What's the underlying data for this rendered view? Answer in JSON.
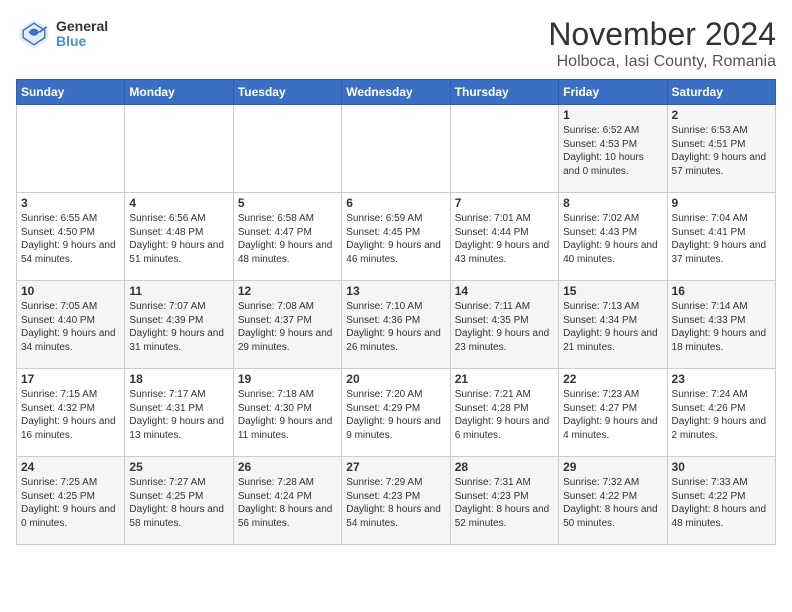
{
  "logo": {
    "general": "General",
    "blue": "Blue"
  },
  "title": "November 2024",
  "subtitle": "Holboca, Iasi County, Romania",
  "weekdays": [
    "Sunday",
    "Monday",
    "Tuesday",
    "Wednesday",
    "Thursday",
    "Friday",
    "Saturday"
  ],
  "weeks": [
    [
      {
        "day": "",
        "info": ""
      },
      {
        "day": "",
        "info": ""
      },
      {
        "day": "",
        "info": ""
      },
      {
        "day": "",
        "info": ""
      },
      {
        "day": "",
        "info": ""
      },
      {
        "day": "1",
        "info": "Sunrise: 6:52 AM\nSunset: 4:53 PM\nDaylight: 10 hours\nand 0 minutes."
      },
      {
        "day": "2",
        "info": "Sunrise: 6:53 AM\nSunset: 4:51 PM\nDaylight: 9 hours\nand 57 minutes."
      }
    ],
    [
      {
        "day": "3",
        "info": "Sunrise: 6:55 AM\nSunset: 4:50 PM\nDaylight: 9 hours\nand 54 minutes."
      },
      {
        "day": "4",
        "info": "Sunrise: 6:56 AM\nSunset: 4:48 PM\nDaylight: 9 hours\nand 51 minutes."
      },
      {
        "day": "5",
        "info": "Sunrise: 6:58 AM\nSunset: 4:47 PM\nDaylight: 9 hours\nand 48 minutes."
      },
      {
        "day": "6",
        "info": "Sunrise: 6:59 AM\nSunset: 4:45 PM\nDaylight: 9 hours\nand 46 minutes."
      },
      {
        "day": "7",
        "info": "Sunrise: 7:01 AM\nSunset: 4:44 PM\nDaylight: 9 hours\nand 43 minutes."
      },
      {
        "day": "8",
        "info": "Sunrise: 7:02 AM\nSunset: 4:43 PM\nDaylight: 9 hours\nand 40 minutes."
      },
      {
        "day": "9",
        "info": "Sunrise: 7:04 AM\nSunset: 4:41 PM\nDaylight: 9 hours\nand 37 minutes."
      }
    ],
    [
      {
        "day": "10",
        "info": "Sunrise: 7:05 AM\nSunset: 4:40 PM\nDaylight: 9 hours\nand 34 minutes."
      },
      {
        "day": "11",
        "info": "Sunrise: 7:07 AM\nSunset: 4:39 PM\nDaylight: 9 hours\nand 31 minutes."
      },
      {
        "day": "12",
        "info": "Sunrise: 7:08 AM\nSunset: 4:37 PM\nDaylight: 9 hours\nand 29 minutes."
      },
      {
        "day": "13",
        "info": "Sunrise: 7:10 AM\nSunset: 4:36 PM\nDaylight: 9 hours\nand 26 minutes."
      },
      {
        "day": "14",
        "info": "Sunrise: 7:11 AM\nSunset: 4:35 PM\nDaylight: 9 hours\nand 23 minutes."
      },
      {
        "day": "15",
        "info": "Sunrise: 7:13 AM\nSunset: 4:34 PM\nDaylight: 9 hours\nand 21 minutes."
      },
      {
        "day": "16",
        "info": "Sunrise: 7:14 AM\nSunset: 4:33 PM\nDaylight: 9 hours\nand 18 minutes."
      }
    ],
    [
      {
        "day": "17",
        "info": "Sunrise: 7:15 AM\nSunset: 4:32 PM\nDaylight: 9 hours\nand 16 minutes."
      },
      {
        "day": "18",
        "info": "Sunrise: 7:17 AM\nSunset: 4:31 PM\nDaylight: 9 hours\nand 13 minutes."
      },
      {
        "day": "19",
        "info": "Sunrise: 7:18 AM\nSunset: 4:30 PM\nDaylight: 9 hours\nand 11 minutes."
      },
      {
        "day": "20",
        "info": "Sunrise: 7:20 AM\nSunset: 4:29 PM\nDaylight: 9 hours\nand 9 minutes."
      },
      {
        "day": "21",
        "info": "Sunrise: 7:21 AM\nSunset: 4:28 PM\nDaylight: 9 hours\nand 6 minutes."
      },
      {
        "day": "22",
        "info": "Sunrise: 7:23 AM\nSunset: 4:27 PM\nDaylight: 9 hours\nand 4 minutes."
      },
      {
        "day": "23",
        "info": "Sunrise: 7:24 AM\nSunset: 4:26 PM\nDaylight: 9 hours\nand 2 minutes."
      }
    ],
    [
      {
        "day": "24",
        "info": "Sunrise: 7:25 AM\nSunset: 4:25 PM\nDaylight: 9 hours\nand 0 minutes."
      },
      {
        "day": "25",
        "info": "Sunrise: 7:27 AM\nSunset: 4:25 PM\nDaylight: 8 hours\nand 58 minutes."
      },
      {
        "day": "26",
        "info": "Sunrise: 7:28 AM\nSunset: 4:24 PM\nDaylight: 8 hours\nand 56 minutes."
      },
      {
        "day": "27",
        "info": "Sunrise: 7:29 AM\nSunset: 4:23 PM\nDaylight: 8 hours\nand 54 minutes."
      },
      {
        "day": "28",
        "info": "Sunrise: 7:31 AM\nSunset: 4:23 PM\nDaylight: 8 hours\nand 52 minutes."
      },
      {
        "day": "29",
        "info": "Sunrise: 7:32 AM\nSunset: 4:22 PM\nDaylight: 8 hours\nand 50 minutes."
      },
      {
        "day": "30",
        "info": "Sunrise: 7:33 AM\nSunset: 4:22 PM\nDaylight: 8 hours\nand 48 minutes."
      }
    ]
  ]
}
